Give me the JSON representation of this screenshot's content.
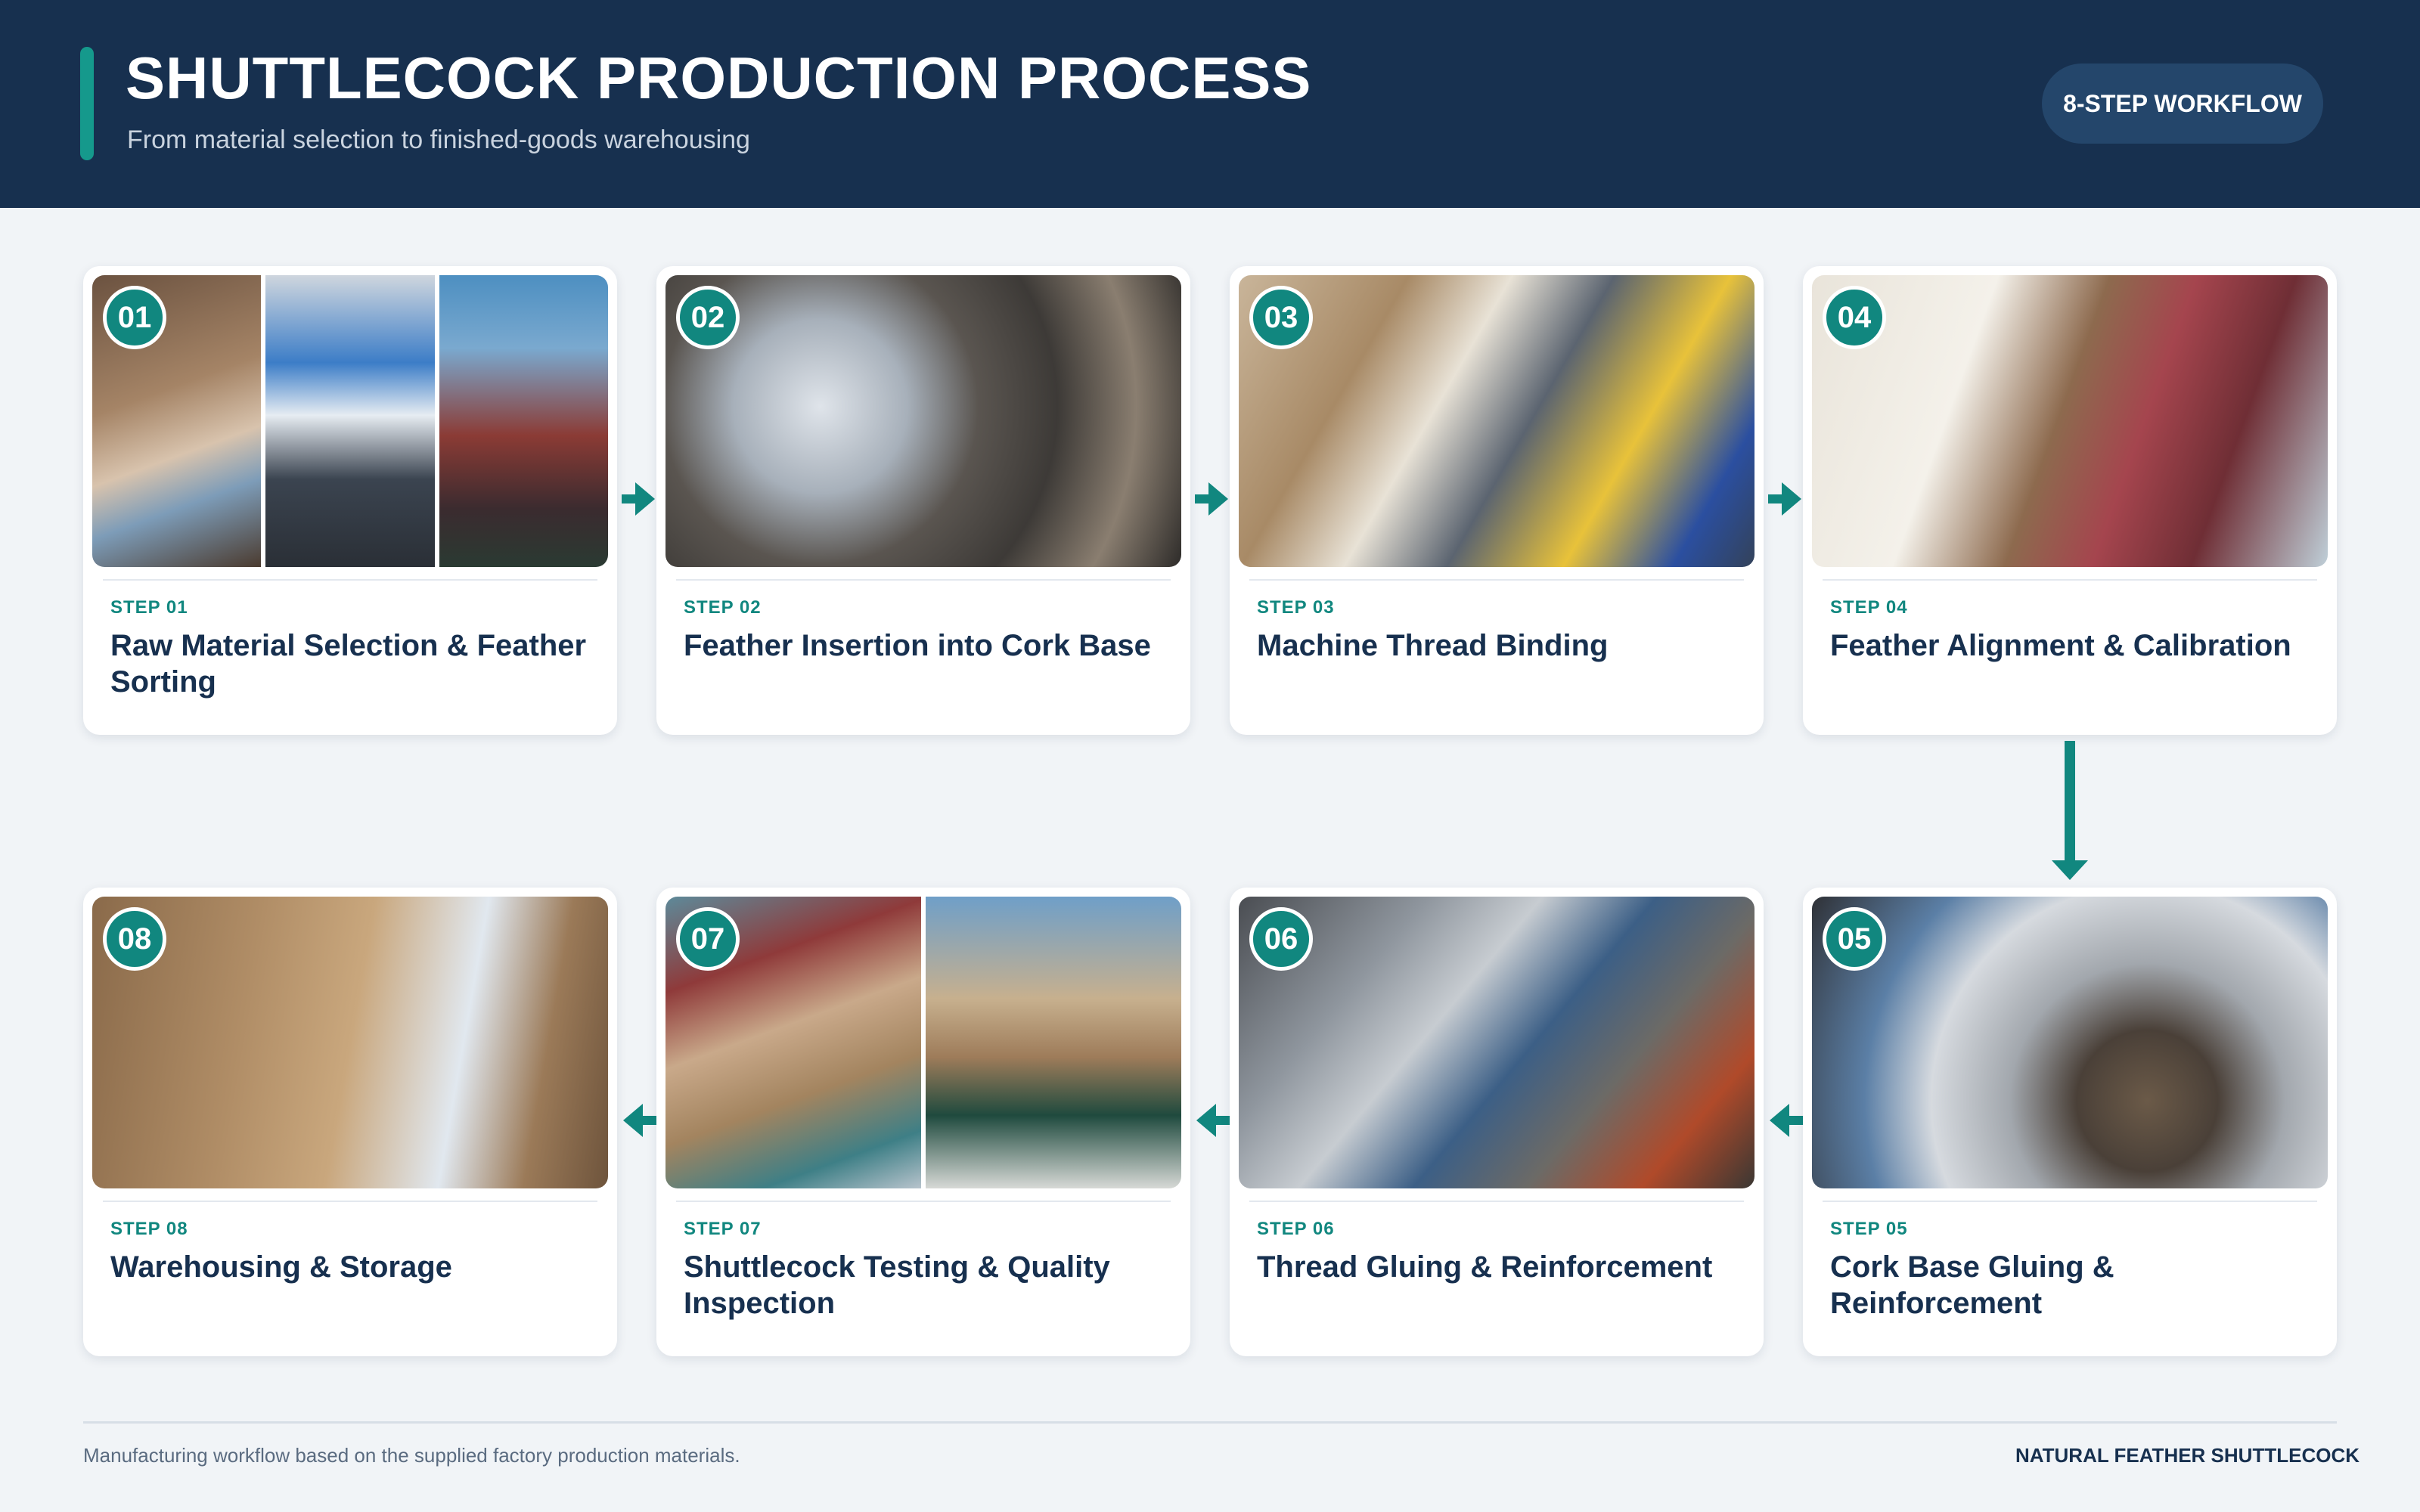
{
  "header": {
    "title": "SHUTTLECOCK PRODUCTION PROCESS",
    "subtitle": "From material selection to finished-goods warehousing",
    "badge": "8-STEP WORKFLOW"
  },
  "steps": [
    {
      "num": "01",
      "label": "STEP 01",
      "title": "Raw Material Selection & Feather Sorting"
    },
    {
      "num": "02",
      "label": "STEP 02",
      "title": "Feather Insertion into Cork Base"
    },
    {
      "num": "03",
      "label": "STEP 03",
      "title": "Machine Thread Binding"
    },
    {
      "num": "04",
      "label": "STEP 04",
      "title": "Feather Alignment & Calibration"
    },
    {
      "num": "05",
      "label": "STEP 05",
      "title": "Cork Base Gluing & Reinforcement"
    },
    {
      "num": "06",
      "label": "STEP 06",
      "title": "Thread Gluing & Reinforcement"
    },
    {
      "num": "07",
      "label": "STEP 07",
      "title": "Shuttlecock Testing & Quality Inspection"
    },
    {
      "num": "08",
      "label": "STEP 08",
      "title": "Warehousing & Storage"
    }
  ],
  "footer": {
    "note": "Manufacturing workflow based on the supplied factory production materials.",
    "brand": "NATURAL FEATHER SHUTTLECOCK"
  },
  "colors": {
    "navy": "#17304f",
    "teal": "#11877f",
    "background": "#f1f4f7"
  }
}
